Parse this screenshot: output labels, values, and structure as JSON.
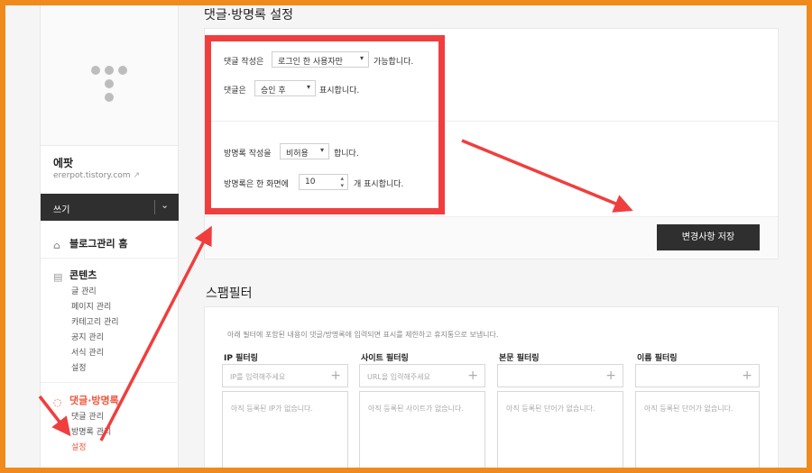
{
  "comment_settings": {
    "title": "댓글·방명록 설정",
    "comment_write_prefix": "댓글 작성은",
    "comment_write_value": "로그인 한 사용자만",
    "comment_write_suffix": "가능합니다.",
    "comment_show_prefix": "댓글은",
    "comment_show_value": "승인 후",
    "comment_show_suffix": "표시합니다.",
    "guestbook_write_prefix": "방명록 작성을",
    "guestbook_write_value": "비허용",
    "guestbook_write_suffix": "합니다.",
    "guestbook_count_prefix": "방명록은 한 화면에",
    "guestbook_count_value": "10",
    "guestbook_count_suffix": "개 표시합니다.",
    "save_label": "변경사항 저장"
  },
  "spam_filter": {
    "title": "스팸필터",
    "description": "아래 필터에 포함된 내용이 댓글/방명록에 입력되면 표시를 제한하고 휴지통으로 보냅니다.",
    "columns": [
      {
        "label": "IP 필터링",
        "placeholder": "IP를 입력해주세요",
        "empty": "아직 등록된 IP가 없습니다."
      },
      {
        "label": "사이트 필터링",
        "placeholder": "URL을 입력해주세요",
        "empty": "아직 등록된 사이트가 없습니다."
      },
      {
        "label": "본문 필터링",
        "placeholder": "",
        "empty": "아직 등록된 단어가 없습니다."
      },
      {
        "label": "이름 필터링",
        "placeholder": "",
        "empty": "아직 등록된 단어가 없습니다."
      }
    ]
  },
  "sidebar": {
    "blog_name": "에팟",
    "blog_url": "ererpot.tistory.com",
    "write_label": "쓰기",
    "home_label": "블로그관리 홈",
    "contents_label": "콘텐츠",
    "contents_items": [
      "글 관리",
      "페이지 관리",
      "카테고리 관리",
      "공지 관리",
      "서식 관리",
      "설정"
    ],
    "comments_label": "댓글·방명록",
    "comments_items": [
      "댓글 관리",
      "방명록 관리",
      "설정"
    ]
  },
  "colors": {
    "accent": "#f2553d",
    "annotation": "#f03e3e",
    "frame": "#f08a1c"
  }
}
